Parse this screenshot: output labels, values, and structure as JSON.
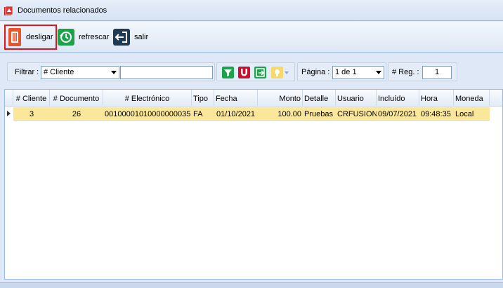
{
  "window": {
    "title": "Documentos relacionados"
  },
  "toolbar": {
    "desligar_label": "desligar",
    "refrescar_label": "refrescar",
    "salir_label": "salir"
  },
  "filter": {
    "filtrar_label": "Filtrar :",
    "field_selected": "# Cliente",
    "value": "",
    "pagina_label": "Página :",
    "pagina_selected": "1 de 1",
    "reg_label": "# Reg. :",
    "reg_value": "1"
  },
  "grid": {
    "columns": [
      "# Cliente",
      "# Documento",
      "# Electrónico",
      "Tipo",
      "Fecha",
      "Monto",
      "Detalle",
      "Usuario",
      "Incluído",
      "Hora",
      "Moneda"
    ],
    "rows": [
      {
        "cliente": "3",
        "documento": "26",
        "electronico": "00100001010000000035",
        "tipo": "FA",
        "fecha": "01/10/2021",
        "monto": "100.00",
        "detalle": "Pruebas",
        "usuario": "CRFUSION",
        "incluido": "09/07/2021",
        "hora": "09:48:35",
        "moneda": "Local"
      }
    ]
  },
  "colors": {
    "accent": "#e0141e",
    "selected_row": "#fbe79a",
    "border": "#99bbe8"
  },
  "icons": {
    "app": "document-app-icon",
    "desligar": "trash-icon",
    "refrescar": "refresh-icon",
    "salir": "exit-icon",
    "filter_apply": "filter-down-icon",
    "filter_clear": "magnet-icon",
    "filter_export": "export-icon",
    "filter_bulb": "bulb-icon"
  }
}
